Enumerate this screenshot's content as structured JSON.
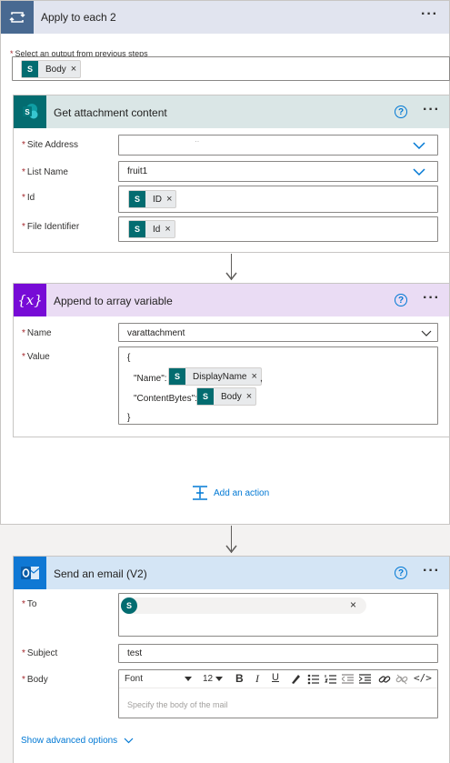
{
  "apply_each": {
    "title": "Apply to each 2",
    "select_label": "Select an output from previous steps",
    "token": {
      "label": "Body",
      "icon": "sharepoint-icon"
    }
  },
  "attachment": {
    "title": "Get attachment content",
    "header_color": "#dae6e6",
    "icon_color": "#036c70",
    "fields": {
      "site_address": {
        "label": "Site Address",
        "value": "··"
      },
      "list_name": {
        "label": "List Name",
        "value": "fruit1"
      },
      "id": {
        "label": "Id",
        "token": "ID"
      },
      "file_identifier": {
        "label": "File Identifier",
        "token": "Id"
      }
    }
  },
  "append": {
    "title": "Append to array variable",
    "header_color": "#eadcf4",
    "icon_color": "#770bd6",
    "icon_glyph": "{x}",
    "name_label": "Name",
    "name_value": "varattachment",
    "value_label": "Value",
    "value_lines": {
      "open": "{",
      "name_key": "\"Name\":",
      "name_token": "DisplayName",
      "name_sep": ",",
      "bytes_key": "\"ContentBytes\":",
      "bytes_token": "Body",
      "close": "}"
    }
  },
  "add_action": {
    "label": "Add an action"
  },
  "email": {
    "title": "Send an email (V2)",
    "header_color": "#d4e5f5",
    "icon_color": "#0f78d4",
    "to_label": "To",
    "to_avatar": "S",
    "subject_label": "Subject",
    "subject_value": "test",
    "body_label": "Body",
    "font_label": "Font",
    "font_size": "12",
    "body_placeholder": "Specify the body of the mail",
    "advanced_label": "Show advanced options"
  },
  "colors": {
    "accent": "#0078d4",
    "required": "#a4262c",
    "loop_icon": "#486991",
    "loop_header": "#e1e4ef"
  }
}
